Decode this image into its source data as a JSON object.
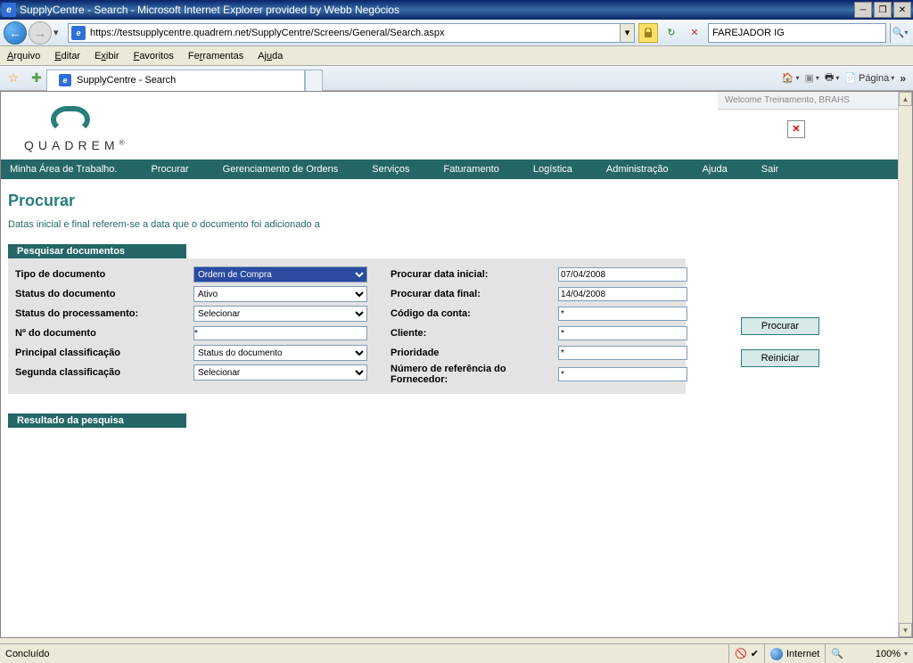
{
  "window": {
    "title": "SupplyCentre - Search - Microsoft Internet Explorer provided by Webb Negócios"
  },
  "nav": {
    "url": "https://testsupplycentre.quadrem.net/SupplyCentre/Screens/General/Search.aspx",
    "searchPlaceholder": "FAREJADOR IG"
  },
  "menubar": [
    "Arquivo",
    "Editar",
    "Exibir",
    "Favoritos",
    "Ferramentas",
    "Ajuda"
  ],
  "tab": {
    "title": "SupplyCentre - Search"
  },
  "tbRight": {
    "page": "Página"
  },
  "welcome": "Welcome  Treinamento, BRAHS",
  "logo": "QUADREM",
  "mainnav": [
    "Minha Área de Trabalho.",
    "Procurar",
    "Gerenciamento de Ordens",
    "Serviços",
    "Faturamento",
    "Logística",
    "Administração",
    "Ajuda",
    "Sair"
  ],
  "page": {
    "title": "Procurar",
    "subtitle": "Datas inicial e final referem-se a data que o documento foi adicionado a",
    "sectionSearch": "Pesquisar documentos",
    "sectionResult": "Resultado da pesquisa"
  },
  "form": {
    "left": {
      "docType": {
        "label": "Tipo de documento",
        "value": "Ordem de Compra"
      },
      "docStatus": {
        "label": "Status do documento",
        "value": "Ativo"
      },
      "procStatus": {
        "label": "Status do processamento:",
        "value": "Selecionar"
      },
      "docNo": {
        "label": "Nº do documento",
        "value": "*"
      },
      "class1": {
        "label": "Principal classificação",
        "value": "Status do documento"
      },
      "class2": {
        "label": "Segunda classificação",
        "value": "Selecionar"
      }
    },
    "right": {
      "startDate": {
        "label": "Procurar data inicial:",
        "value": "07/04/2008"
      },
      "endDate": {
        "label": "Procurar data final:",
        "value": "14/04/2008"
      },
      "acctCode": {
        "label": "Código da conta:",
        "value": "*"
      },
      "client": {
        "label": "Cliente:",
        "value": "*"
      },
      "priority": {
        "label": "Prioridade",
        "value": "*"
      },
      "supplierRef": {
        "label": "Número de referência do Fornecedor:",
        "value": "*"
      }
    }
  },
  "actions": {
    "search": "Procurar",
    "reset": "Reiniciar"
  },
  "status": {
    "done": "Concluído",
    "zone": "Internet",
    "zoom": "100%"
  }
}
